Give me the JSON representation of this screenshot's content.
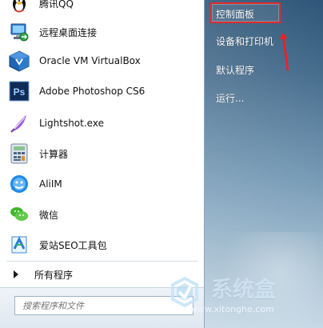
{
  "programs": [
    {
      "label": "腾讯QQ",
      "icon": "qq-penguin-icon"
    },
    {
      "label": "远程桌面连接",
      "icon": "remote-desktop-icon"
    },
    {
      "label": "Oracle VM VirtualBox",
      "icon": "virtualbox-icon"
    },
    {
      "label": "Adobe Photoshop CS6",
      "icon": "photoshop-icon"
    },
    {
      "label": "Lightshot.exe",
      "icon": "lightshot-feather-icon"
    },
    {
      "label": "计算器",
      "icon": "calculator-icon"
    },
    {
      "label": "AliIM",
      "icon": "aliim-icon"
    },
    {
      "label": "微信",
      "icon": "wechat-icon"
    },
    {
      "label": "爱站SEO工具包",
      "icon": "aizhan-seo-icon"
    }
  ],
  "all_programs": {
    "label": "所有程序",
    "icon": "right-triangle-icon"
  },
  "search": {
    "placeholder": "搜索程序和文件"
  },
  "right_menu": [
    {
      "label": "控制面板",
      "selected": true
    },
    {
      "label": "设备和打印机"
    },
    {
      "label": "默认程序"
    },
    {
      "label": "运行..."
    }
  ],
  "watermark": {
    "title": "系统盒",
    "url": "www.xitonghe.com"
  },
  "colors": {
    "highlight": "#e12b2b",
    "panel_blue": "#476d8d",
    "left_bg": "#ffffff"
  }
}
